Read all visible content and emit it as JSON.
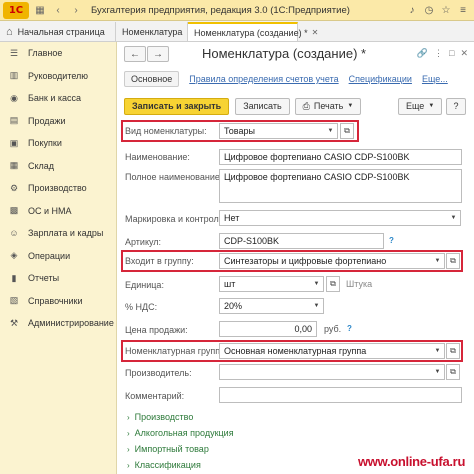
{
  "titlebar": {
    "logo": "1С",
    "title": "Бухгалтерия предприятия, редакция 3.0  (1С:Предприятие)"
  },
  "tabs": {
    "home": "Начальная страница",
    "tab1": "Номенклатура",
    "active": "Номенклатура (создание) *"
  },
  "sidebar": {
    "items": [
      {
        "label": "Главное",
        "icon": "menu-icon"
      },
      {
        "label": "Руководителю",
        "icon": "chart-icon"
      },
      {
        "label": "Банк и касса",
        "icon": "bank-icon"
      },
      {
        "label": "Продажи",
        "icon": "sales-icon"
      },
      {
        "label": "Покупки",
        "icon": "purchase-icon"
      },
      {
        "label": "Склад",
        "icon": "warehouse-icon"
      },
      {
        "label": "Производство",
        "icon": "production-icon"
      },
      {
        "label": "ОС и НМА",
        "icon": "assets-icon"
      },
      {
        "label": "Зарплата и кадры",
        "icon": "salary-icon"
      },
      {
        "label": "Операции",
        "icon": "operations-icon"
      },
      {
        "label": "Отчеты",
        "icon": "reports-icon"
      },
      {
        "label": "Справочники",
        "icon": "directories-icon"
      },
      {
        "label": "Администрирование",
        "icon": "admin-icon"
      }
    ]
  },
  "header": {
    "title": "Номенклатура (создание) *"
  },
  "links": {
    "main": "Основное",
    "rules": "Правила определения счетов учета",
    "specs": "Спецификации",
    "more": "Еще..."
  },
  "toolbar": {
    "save_close": "Записать и закрыть",
    "save": "Записать",
    "print": "Печать",
    "more": "Еще",
    "help": "?"
  },
  "form": {
    "kind_label": "Вид номенклатуры:",
    "kind_value": "Товары",
    "name_label": "Наименование:",
    "name_value": "Цифровое фортепиано CASIO CDP-S100BK",
    "fullname_label": "Полное наименование:",
    "fullname_value": "Цифровое фортепиано CASIO CDP-S100BK",
    "marking_label": "Маркировка и контроль:",
    "marking_value": "Нет",
    "article_label": "Артикул:",
    "article_value": "CDP-S100BK",
    "group_label": "Входит в группу:",
    "group_value": "Синтезаторы и цифровые фортепиано",
    "unit_label": "Единица:",
    "unit_value": "шт",
    "unit_hint": "Штука",
    "vat_label": "% НДС:",
    "vat_value": "20%",
    "price_label": "Цена продажи:",
    "price_value": "0,00",
    "price_unit": "руб.",
    "nomgroup_label": "Номенклатурная группа:",
    "nomgroup_value": "Основная номенклатурная группа",
    "producer_label": "Производитель:",
    "producer_value": "",
    "comment_label": "Комментарий:",
    "comment_value": ""
  },
  "groups": [
    "Производство",
    "Алкогольная продукция",
    "Импортный товар",
    "Классификация"
  ],
  "watermark": "www.online-ufa.ru",
  "colors": {
    "accent": "#f7d333",
    "sidebar": "#fbf3d0",
    "highlight": "#d6263a",
    "link": "#3a6bb0",
    "group": "#2d7a3a"
  }
}
